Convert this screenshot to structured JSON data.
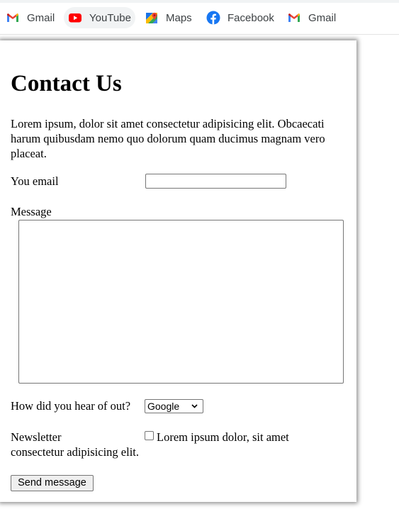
{
  "bookmarks": [
    {
      "label": "Gmail",
      "icon": "gmail-icon"
    },
    {
      "label": "YouTube",
      "icon": "youtube-icon"
    },
    {
      "label": "Maps",
      "icon": "maps-icon"
    },
    {
      "label": "Facebook",
      "icon": "facebook-icon"
    },
    {
      "label": "Gmail",
      "icon": "gmail-icon"
    }
  ],
  "form": {
    "title": "Contact Us",
    "intro": "Lorem ipsum, dolor sit amet consectetur adipisicing elit. Obcaecati harum quibusdam nemo quo dolorum quam ducimus magnam vero placeat.",
    "email_label": "You email",
    "email_value": "",
    "message_label": "Message",
    "message_value": "",
    "source_label": "How did you hear of out?",
    "source_selected": "Google",
    "newsletter_label": "Newsletter",
    "newsletter_checked": false,
    "newsletter_text": "Lorem ipsum dolor, sit amet consectetur adipisicing elit.",
    "send_label": "Send message"
  },
  "colors": {
    "youtube_red": "#ff0000",
    "facebook_blue": "#1877f2",
    "button_bg": "#efefef",
    "border": "#767676"
  }
}
